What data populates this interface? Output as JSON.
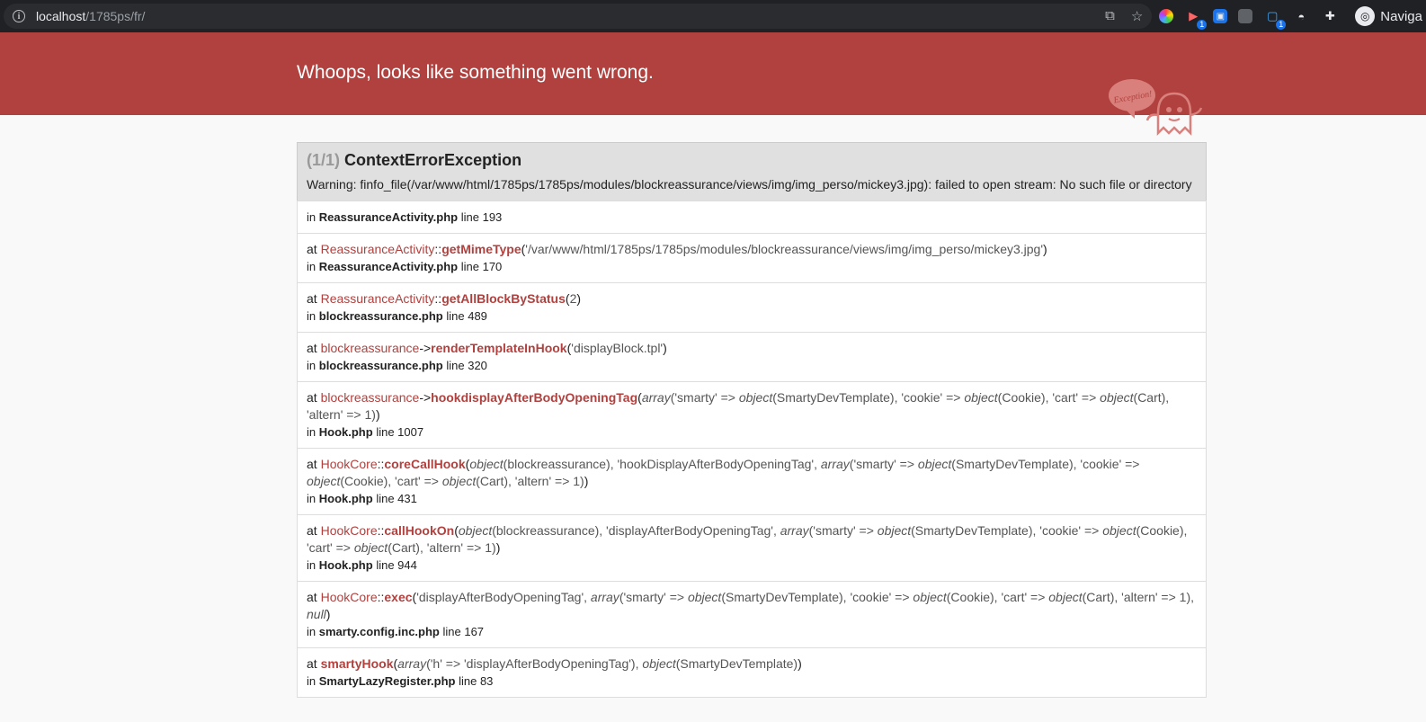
{
  "browser": {
    "url_host": "localhost",
    "url_path": "/1785ps/fr/",
    "profile_label": "Naviga",
    "ext_badge_1": "1",
    "ext_badge_2": "1"
  },
  "header": {
    "title": "Whoops, looks like something went wrong.",
    "logo_text": "Exception!"
  },
  "exception": {
    "counter": "(1/1)",
    "name": "ContextErrorException",
    "message": "Warning: finfo_file(/var/www/html/1785ps/1785ps/modules/blockreassurance/views/img/img_perso/mickey3.jpg): failed to open stream: No such file or directory"
  },
  "trace": [
    {
      "file": "ReassuranceActivity.php",
      "line": "line 193"
    },
    {
      "cls": "ReassuranceActivity",
      "sep": "::",
      "fn": "getMimeType",
      "args_html": "'/var/www/html/1785ps/1785ps/modules/blockreassurance/views/img/img_perso/mickey3.jpg'",
      "file": "ReassuranceActivity.php",
      "line": "line 170"
    },
    {
      "cls": "ReassuranceActivity",
      "sep": "::",
      "fn": "getAllBlockByStatus",
      "args_html": "2",
      "file": "blockreassurance.php",
      "line": "line 489"
    },
    {
      "cls": "blockreassurance",
      "sep": "->",
      "fn": "renderTemplateInHook",
      "args_html": "'displayBlock.tpl'",
      "file": "blockreassurance.php",
      "line": "line 320"
    },
    {
      "cls": "blockreassurance",
      "sep": "->",
      "fn": "hookdisplayAfterBodyOpeningTag",
      "file": "Hook.php",
      "line": "line 1007"
    },
    {
      "cls": "HookCore",
      "sep": "::",
      "fn": "coreCallHook",
      "file": "Hook.php",
      "line": "line 431"
    },
    {
      "cls": "HookCore",
      "sep": "::",
      "fn": "callHookOn",
      "file": "Hook.php",
      "line": "line 944"
    },
    {
      "cls": "HookCore",
      "sep": "::",
      "fn": "exec",
      "file": "smarty.config.inc.php",
      "line": "line 167"
    },
    {
      "cls": "",
      "sep": "",
      "fn": "smartyHook",
      "file": "SmartyLazyRegister.php",
      "line": "line 83"
    }
  ],
  "labels": {
    "in": "in",
    "at": "at"
  }
}
